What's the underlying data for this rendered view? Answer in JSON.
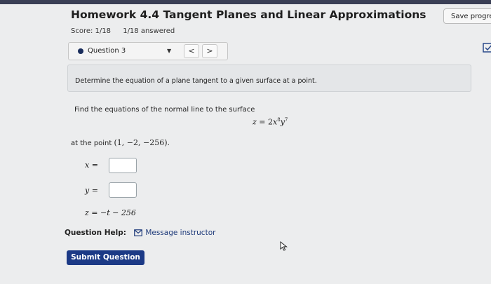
{
  "header": {
    "title": "Homework 4.4 Tangent Planes and Linear Approximations",
    "score": "Score: 1/18",
    "answered": "1/18 answered",
    "save_label": "Save progress"
  },
  "question_nav": {
    "label": "Question 3",
    "prev": "<",
    "next": ">"
  },
  "instructions": "Determine the equation of a plane tangent to a given surface at a point.",
  "question": {
    "prompt": "Find the equations of the normal line to the surface",
    "surface": {
      "lhs": "z",
      "eq": " = 2",
      "x": "x",
      "x_exp": "8",
      "y": "y",
      "y_exp": "7"
    },
    "at_label": "at the point ",
    "point": "(1, −2, −256).",
    "answers": [
      {
        "var": "x",
        "eq": " =",
        "value": ""
      },
      {
        "var": "y",
        "eq": " =",
        "value": ""
      }
    ],
    "z_line": "z = −t − 256"
  },
  "help": {
    "label": "Question Help:",
    "link": "Message instructor"
  },
  "submit_label": "Submit Question",
  "colors": {
    "accent": "#1c3a86",
    "page_bg": "#ecedee"
  }
}
